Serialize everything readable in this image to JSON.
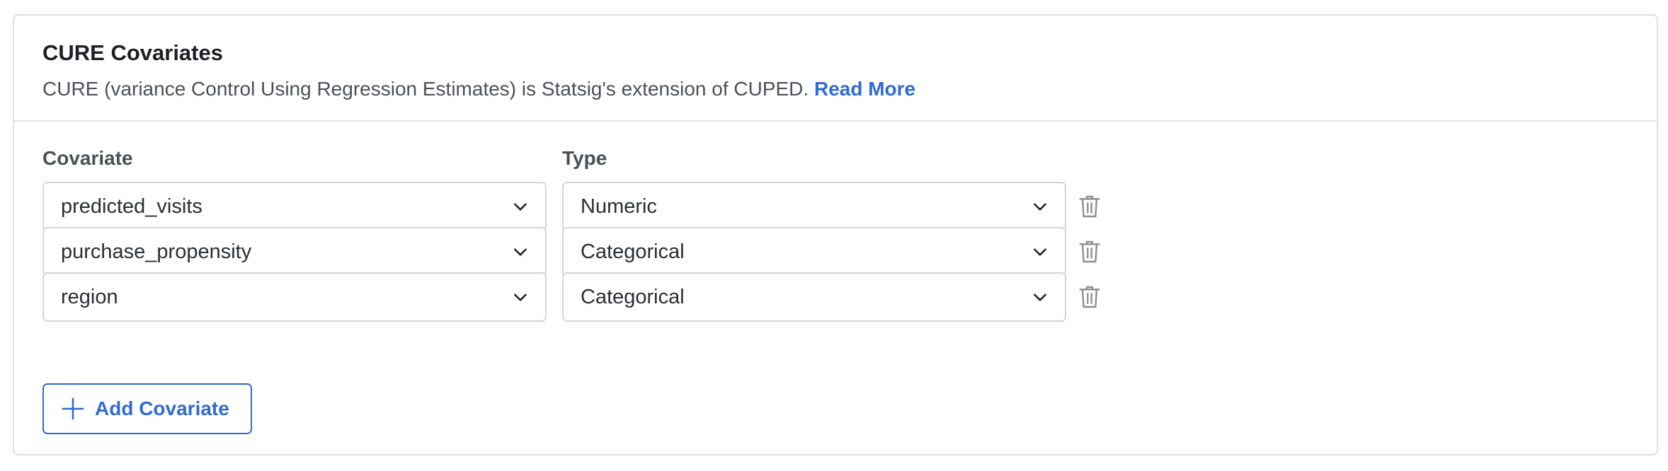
{
  "section": {
    "title": "CURE Covariates",
    "description": "CURE (variance Control Using Regression Estimates) is Statsig's extension of CUPED.",
    "read_more_label": "Read More"
  },
  "columns": {
    "covariate_label": "Covariate",
    "type_label": "Type"
  },
  "rows": [
    {
      "covariate": "predicted_visits",
      "type": "Numeric"
    },
    {
      "covariate": "purchase_propensity",
      "type": "Categorical"
    },
    {
      "covariate": "region",
      "type": "Categorical"
    }
  ],
  "add_button_label": "Add Covariate",
  "icons": {
    "dropdown": "chevron-down-icon",
    "delete": "trash-icon",
    "add": "plus-icon"
  },
  "colors": {
    "accent": "#2f6bd1",
    "border": "#d3d7dc",
    "title": "#1c1f24",
    "muted_text": "#4b5058",
    "icon_gray": "#8a8f96"
  }
}
